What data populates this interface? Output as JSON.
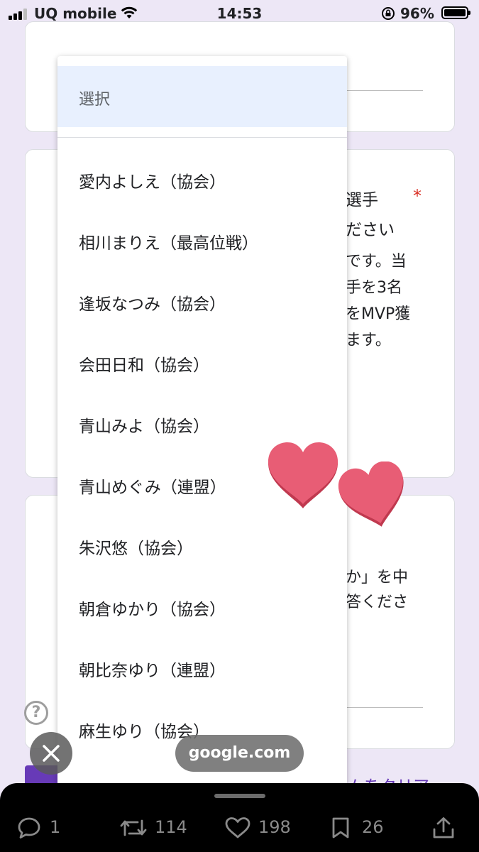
{
  "status_bar": {
    "carrier": "UQ mobile",
    "time": "14:53",
    "battery": "96%"
  },
  "dropdown": {
    "placeholder": "選択",
    "options": [
      "愛内よしえ（協会）",
      "相川まりえ（最高位戦）",
      "逢坂なつみ（協会）",
      "会田日和（協会）",
      "青山みよ（協会）",
      "青山めぐみ（連盟）",
      "朱沢悠（協会）",
      "朝倉ゆかり（協会）",
      "朝比奈ゆり（連盟）",
      "麻生ゆり（協会）"
    ]
  },
  "form_peek": {
    "q2_line1": "選手",
    "q2_line2": "ださい",
    "q2_desc1": "です。当",
    "q2_desc2": "手を3名",
    "q2_desc3": "をMVP獲",
    "q2_desc4": "ます。",
    "required_mark": "*",
    "q3_line1": "か」を中",
    "q3_line2": "答くださ",
    "clear_link": "ムをクリア"
  },
  "help_icon_glyph": "?",
  "url_pill": "google.com",
  "actions": {
    "reply_count": "1",
    "retweet_count": "114",
    "like_count": "198",
    "bookmark_count": "26"
  },
  "colors": {
    "accent": "#673ab7",
    "required": "#d93025",
    "selected_bg": "#e8f0fe",
    "heart": "#e85d75",
    "page_bg": "#ede7f6"
  }
}
